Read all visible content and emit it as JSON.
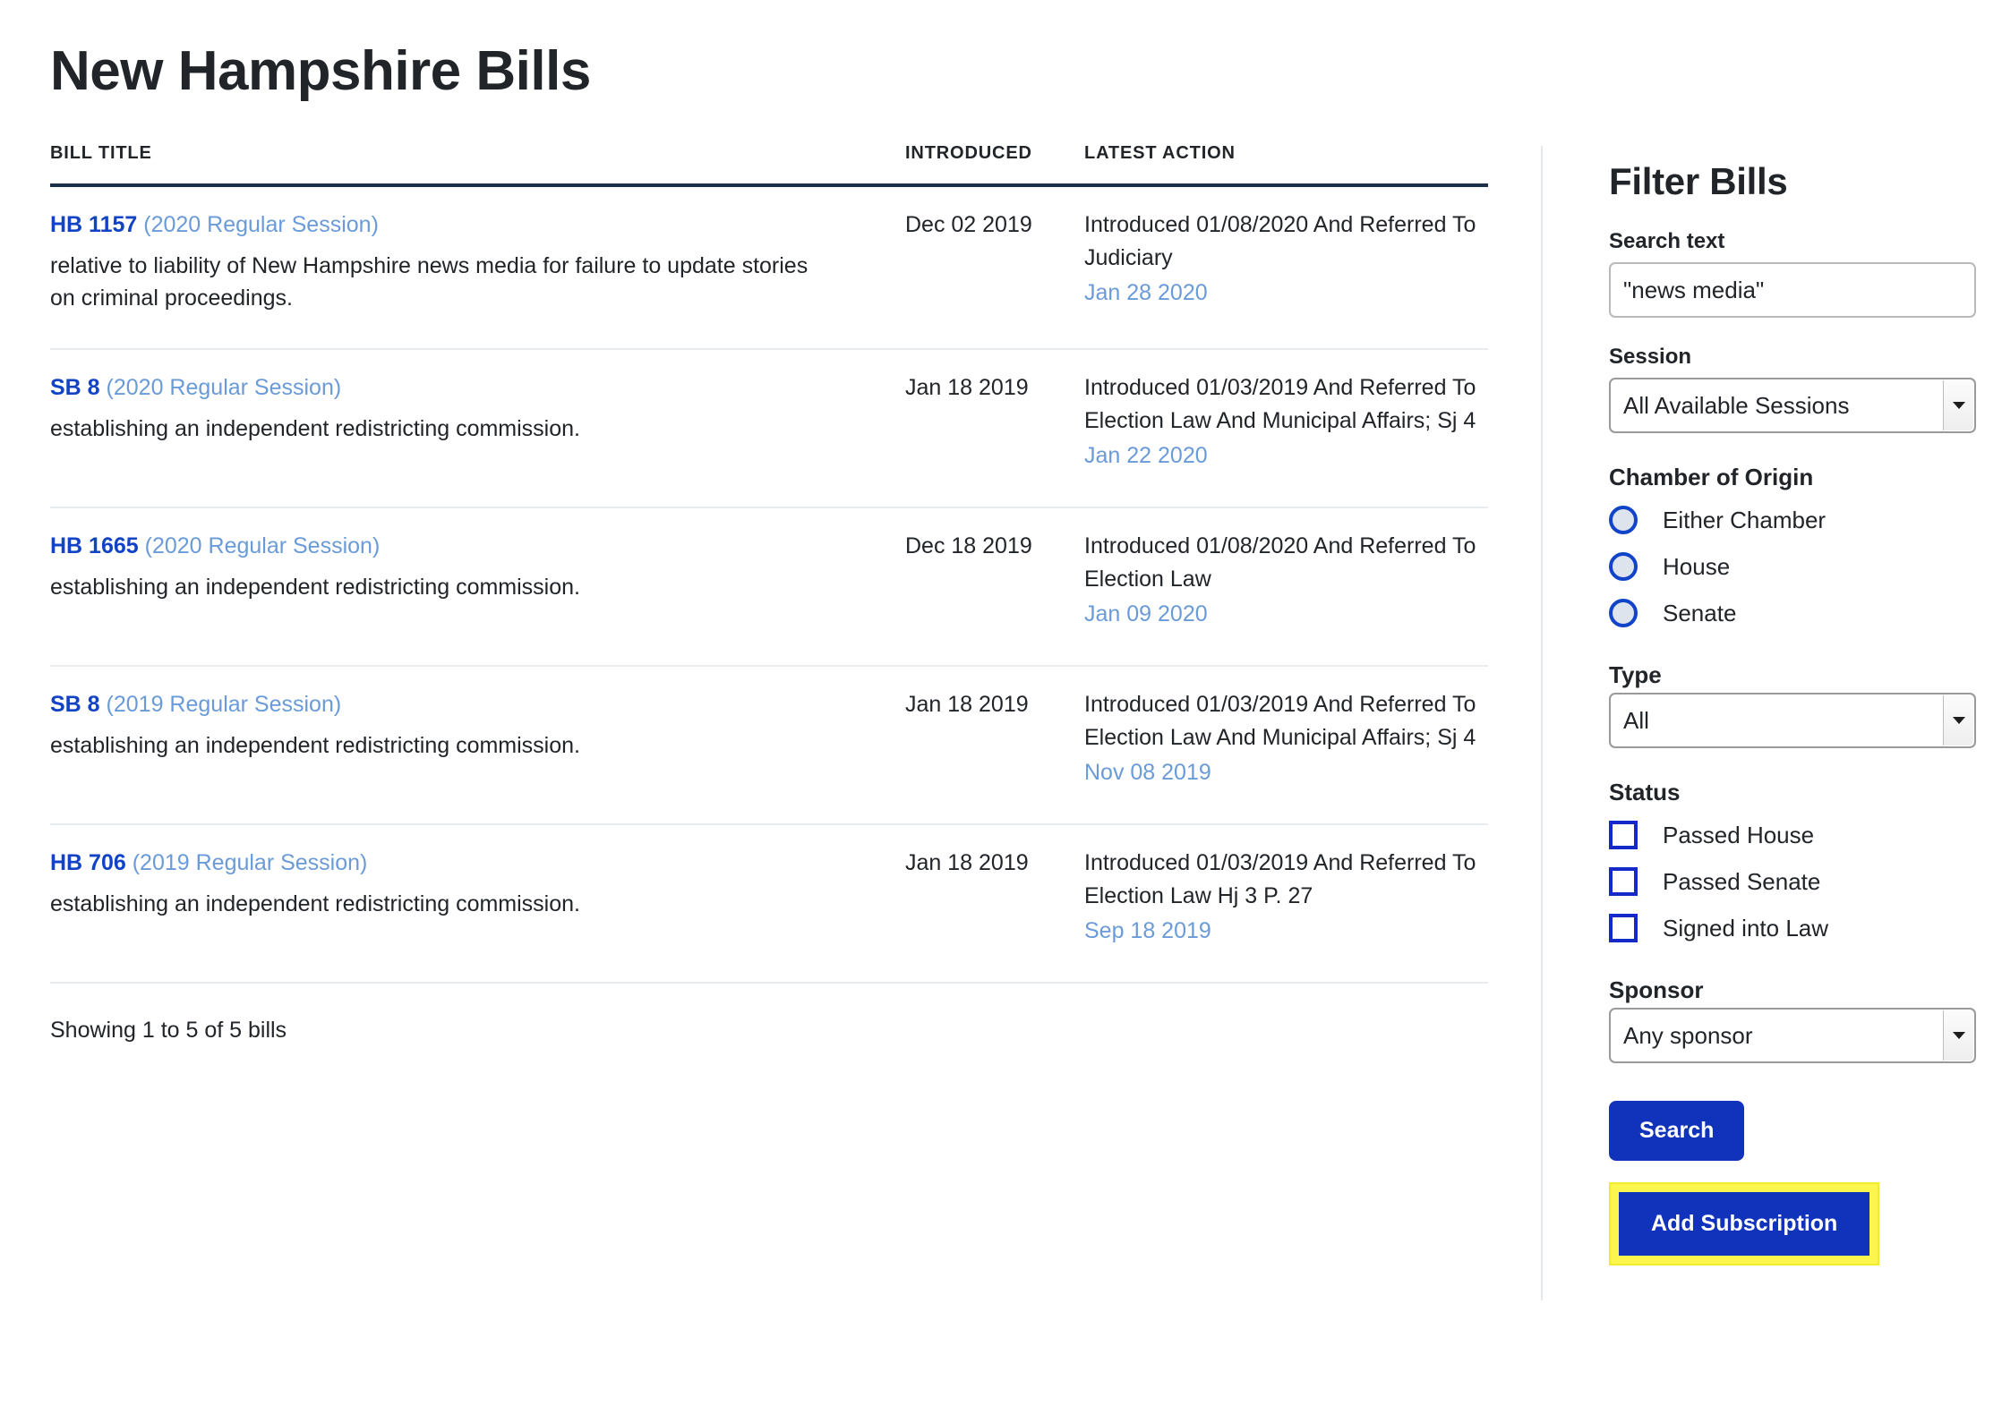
{
  "page_title": "New Hampshire Bills",
  "table": {
    "headers": {
      "bill_title": "BILL TITLE",
      "introduced": "INTRODUCED",
      "latest_action": "LATEST ACTION"
    },
    "rows": [
      {
        "bill_id": "HB 1157",
        "session": "(2020 Regular Session)",
        "description": "relative to liability of New Hampshire news media for failure to update stories on criminal proceedings.",
        "introduced": "Dec 02 2019",
        "action_text": "Introduced 01/08/2020 And Referred To Judiciary",
        "action_date": "Jan 28 2020"
      },
      {
        "bill_id": "SB 8",
        "session": "(2020 Regular Session)",
        "description": "establishing an independent redistricting commission.",
        "introduced": "Jan 18 2019",
        "action_text": "Introduced 01/03/2019 And Referred To Election Law And Municipal Affairs; Sj 4",
        "action_date": "Jan 22 2020"
      },
      {
        "bill_id": "HB 1665",
        "session": "(2020 Regular Session)",
        "description": "establishing an independent redistricting commission.",
        "introduced": "Dec 18 2019",
        "action_text": "Introduced 01/08/2020 And Referred To Election Law",
        "action_date": "Jan 09 2020"
      },
      {
        "bill_id": "SB 8",
        "session": "(2019 Regular Session)",
        "description": "establishing an independent redistricting commission.",
        "introduced": "Jan 18 2019",
        "action_text": "Introduced 01/03/2019 And Referred To Election Law And Municipal Affairs; Sj 4",
        "action_date": "Nov 08 2019"
      },
      {
        "bill_id": "HB 706",
        "session": "(2019 Regular Session)",
        "description": "establishing an independent redistricting commission.",
        "introduced": "Jan 18 2019",
        "action_text": "Introduced 01/03/2019 And Referred To Election Law Hj 3 P. 27",
        "action_date": "Sep 18 2019"
      }
    ],
    "showing": "Showing 1 to 5 of 5 bills"
  },
  "sidebar": {
    "title": "Filter Bills",
    "search_text": {
      "label": "Search text",
      "value": "\"news media\""
    },
    "session": {
      "label": "Session",
      "selected": "All Available Sessions"
    },
    "chamber": {
      "label": "Chamber of Origin",
      "options": [
        {
          "label": "Either Chamber"
        },
        {
          "label": "House"
        },
        {
          "label": "Senate"
        }
      ]
    },
    "type": {
      "label": "Type",
      "selected": "All"
    },
    "status": {
      "label": "Status",
      "options": [
        {
          "label": "Passed House"
        },
        {
          "label": "Passed Senate"
        },
        {
          "label": "Signed into Law"
        }
      ]
    },
    "sponsor": {
      "label": "Sponsor",
      "selected": "Any sponsor"
    },
    "search_button": "Search",
    "subscribe_button": "Add Subscription"
  },
  "colors": {
    "link_blue": "#1143c4",
    "muted_blue": "#6a9bd8",
    "header_rule": "#1b3049",
    "button_blue": "#1133bb",
    "highlight_yellow": "#fbf54d",
    "control_blue": "#1244c9"
  }
}
